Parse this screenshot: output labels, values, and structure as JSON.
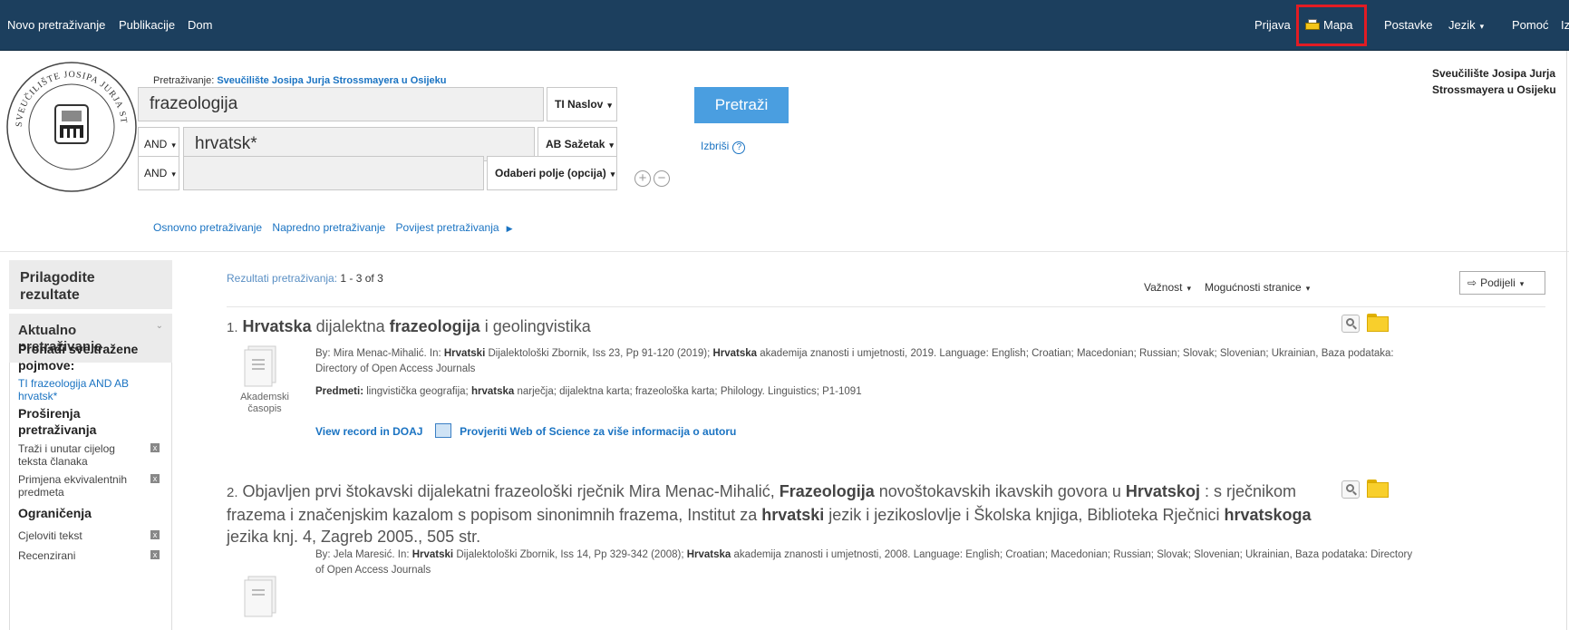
{
  "topnav": {
    "left": [
      "Novo pretraživanje",
      "Publikacije",
      "Dom"
    ],
    "right": {
      "prijava": "Prijava",
      "mapa": "Mapa",
      "postavke": "Postavke",
      "jezik": "Jezik",
      "pomoc": "Pomoć",
      "izlaz": "Izlaz"
    }
  },
  "search": {
    "label": "Pretraživanje:",
    "source": "Sveučilište Josipa Jurja Strossmayera u Osijeku",
    "rows": [
      {
        "operator": "",
        "value": "frazeologija",
        "field": "TI Naslov"
      },
      {
        "operator": "AND",
        "value": "hrvatsk*",
        "field": "AB Sažetak"
      },
      {
        "operator": "AND",
        "value": "",
        "field": "Odaberi polje (opcija)"
      }
    ],
    "submit": "Pretraži",
    "clear": "Izbriši",
    "help": "?",
    "add": "+",
    "remove": "−",
    "links": [
      "Osnovno pretraživanje",
      "Napredno pretraživanje",
      "Povijest pretraživanja"
    ],
    "org_line1": "Sveučilište Josipa Jurja",
    "org_line2": "Strossmayera u Osijeku"
  },
  "sidebar": {
    "heading_line1": "Prilagodite",
    "heading_line2": "rezultate",
    "section_line1": "Aktualno",
    "section_line2": "pretraživanje",
    "find_all_line1": "Pronađi sve tražene",
    "find_all_line2": "pojmove:",
    "query_line1": "TI frazeologija AND AB",
    "query_line2": "hrvatsk*",
    "expanders_line1": "Proširenja",
    "expanders_line2": "pretraživanja",
    "expander_items": [
      {
        "line1": "Traži i unutar cijelog",
        "line2": "teksta članaka"
      },
      {
        "line1": "Primjena ekvivalentnih",
        "line2": "predmeta"
      }
    ],
    "limits_heading": "Ograničenja",
    "limit_items": [
      "Cjeloviti tekst",
      "Recenzirani"
    ],
    "remove_glyph": "x"
  },
  "results": {
    "count_label": "Rezultati pretraživanja:",
    "count_value": "1 - 3 of 3",
    "sort": "Važnost",
    "page_options": "Mogućnosti stranice",
    "share": "Podijeli",
    "items": [
      {
        "number": "1.",
        "meta": "By: Mira Menac-Mihalić. In: Hrvatski Dijalektološki Zbornik, Iss 23, Pp 91-120 (2019); Hrvatska akademija znanosti i umjetnosti, 2019. Language: English; Croatian; Macedonian; Russian; Slovak; Slovenian; Ukrainian, Baza podataka: Directory of Open Access Journals",
        "subjects_label": "Predmeti:",
        "subjects": "lingvistička geografija; hrvatska narječja; dijalektna karta; frazeološka karta; Philology. Linguistics; P1-1091",
        "pubtype_line1": "Akademski",
        "pubtype_line2": "časopis",
        "link_doaj": "View record in DOAJ",
        "link_wos": "Provjeriti Web of Science za više informacija o autoru"
      },
      {
        "number": "2.",
        "meta": "By: Jela Maresić. In: Hrvatski Dijalektološki Zbornik, Iss 14, Pp 329-342 (2008); Hrvatska akademija znanosti i umjetnosti, 2008. Language: English; Croatian; Macedonian; Russian; Slovak; Slovenian; Ukrainian, Baza podataka: Directory of Open Access Journals"
      }
    ]
  },
  "colors": {
    "nav_bg": "#1c3f5e",
    "accent": "#4a9ee0",
    "link": "#1a73c2",
    "highlight_box": "#e21c24"
  }
}
